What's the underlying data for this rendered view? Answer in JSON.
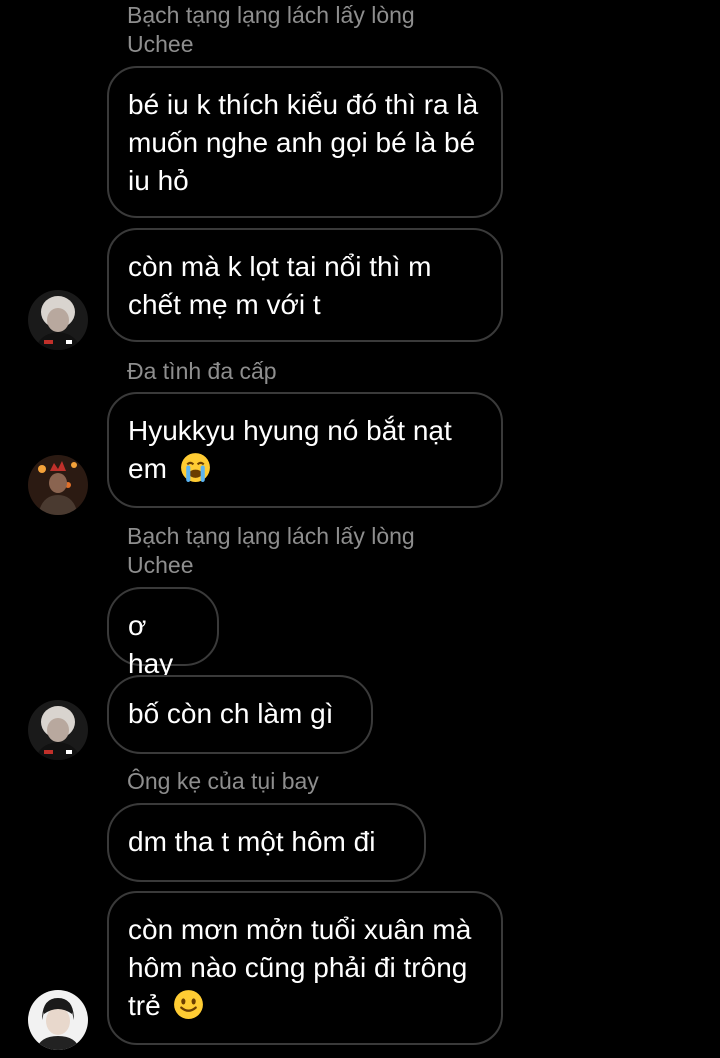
{
  "messages": [
    {
      "sender": "Bạch tạng lạng lách lấy lòng Uchee",
      "bubbles": [
        "bé iu k thích kiểu đó thì ra là muốn nghe anh gọi bé là bé iu hỏ",
        "còn mà k lọt tai nổi thì m chết mẹ m với t"
      ]
    },
    {
      "sender": "Đa tình đa cấp",
      "bubbles": [
        "Hyukkyu hyung nó bắt nạt em"
      ],
      "emoji": "loudly-crying-face"
    },
    {
      "sender": "Bạch tạng lạng lách lấy lòng Uchee",
      "bubbles": [
        "ơ hay",
        "bố còn ch làm gì"
      ]
    },
    {
      "sender": "Ông kẹ của tụi bay",
      "bubbles": [
        "dm tha t một hôm đi",
        "còn mơn mởn tuổi xuân mà hôm nào cũng phải đi trông trẻ"
      ],
      "emoji": "slightly-smiling-face"
    }
  ]
}
